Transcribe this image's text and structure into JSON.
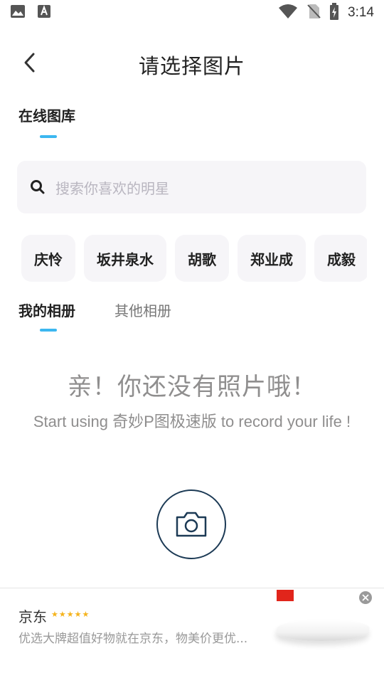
{
  "status_bar": {
    "time": "3:14",
    "left_icons": [
      "image-icon",
      "text-a-icon"
    ],
    "right_icons": [
      "wifi-icon",
      "no-sim-icon",
      "battery-charging-icon"
    ]
  },
  "header": {
    "title": "请选择图片",
    "back_icon": "chevron-left-icon"
  },
  "online_gallery": {
    "tab_label": "在线图库",
    "search_placeholder": "搜索你喜欢的明星",
    "chips": [
      "庆怜",
      "坂井泉水",
      "胡歌",
      "郑业成",
      "成毅"
    ]
  },
  "album_tabs": {
    "items": [
      "我的相册",
      "其他相册"
    ],
    "active_index": 0
  },
  "empty_state": {
    "title": "亲！你还没有照片哦！",
    "subtitle": "Start using 奇妙P图极速版 to record your life !"
  },
  "ad": {
    "name": "京东",
    "stars": "★★★★★",
    "description": "优选大牌超值好物就在京东，物美价更优..."
  },
  "colors": {
    "accent": "#3cb7f0",
    "chip_bg": "#f6f5f8",
    "muted_text": "#8f8e8e",
    "camera_ring": "#1c3a55"
  }
}
